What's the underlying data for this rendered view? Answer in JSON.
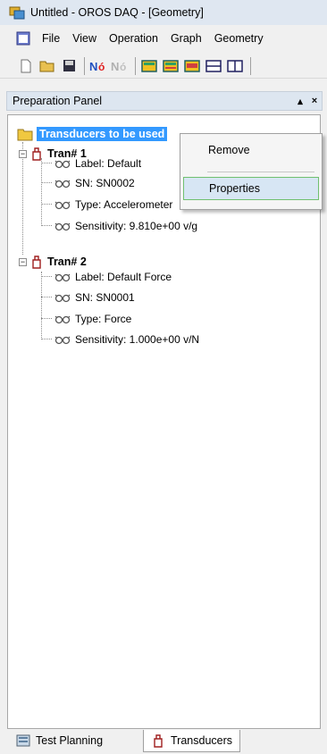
{
  "window": {
    "title": "Untitled - OROS DAQ - [Geometry]"
  },
  "menubar": {
    "items": [
      "File",
      "View",
      "Operation",
      "Graph",
      "Geometry"
    ]
  },
  "toolbar": {
    "buttons": [
      "new-icon",
      "open-icon",
      "save-icon",
      "no-icon",
      "no-disabled-icon",
      "layout-1-icon",
      "layout-2-icon",
      "layout-3-icon",
      "split-horizontal-icon",
      "split-vertical-icon"
    ]
  },
  "panel": {
    "title": "Preparation Panel",
    "pin_glyph": "▴",
    "close_glyph": "×"
  },
  "tree": {
    "root_label": "Transducers to be used",
    "transducers": [
      {
        "label": "Tran# 1",
        "props": [
          "Label: Default ",
          "SN: SN0002",
          "Type: Accelerometer",
          "Sensitivity: 9.810e+00 v/g"
        ]
      },
      {
        "label": "Tran# 2",
        "props": [
          "Label: Default Force",
          "SN: SN0001",
          "Type: Force",
          "Sensitivity: 1.000e+00 v/N"
        ]
      }
    ]
  },
  "context_menu": {
    "remove": "Remove",
    "properties": "Properties"
  },
  "tabs": {
    "test_planning": "Test Planning",
    "transducers": "Transducers"
  },
  "colors": {
    "selection": "#3399ff",
    "highlight": "#d7e6f4",
    "highlight_border": "#70c070"
  }
}
